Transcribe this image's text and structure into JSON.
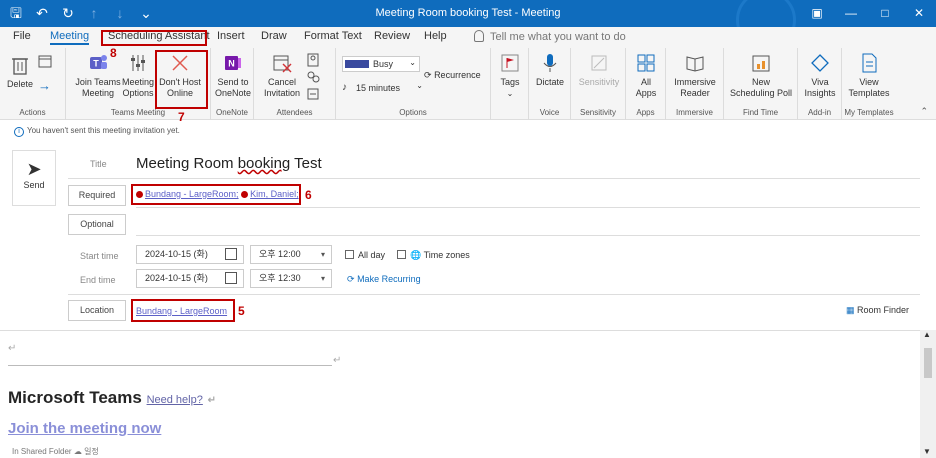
{
  "window": {
    "title": "Meeting Room booking Test  -  Meeting",
    "qat_icons": [
      "save-icon",
      "undo-icon",
      "redo-icon",
      "up-icon",
      "down-icon",
      "more-icon"
    ],
    "controls": [
      "ribbon-display-icon",
      "minimize-icon",
      "maximize-icon",
      "close-icon"
    ]
  },
  "tabs": [
    "File",
    "Meeting",
    "Scheduling Assistant",
    "Insert",
    "Draw",
    "Format Text",
    "Review",
    "Help"
  ],
  "active_tab": "Meeting",
  "tell_me": "Tell me what you want to do",
  "ribbon": {
    "actions": {
      "delete": "Delete",
      "group": "Actions"
    },
    "teams": {
      "join1": "Join Teams",
      "join2": "Meeting",
      "opt1": "Meeting",
      "opt2": "Options",
      "dont1": "Don't Host",
      "dont2": "Online",
      "group": "Teams Meeting"
    },
    "onenote": {
      "label1": "Send to",
      "label2": "OneNote",
      "group": "OneNote"
    },
    "attendees": {
      "cancel1": "Cancel",
      "cancel2": "Invitation",
      "group": "Attendees"
    },
    "options": {
      "busy": "Busy",
      "reminder": "15 minutes",
      "recurrence": "Recurrence",
      "group": "Options"
    },
    "tags": {
      "label": "Tags"
    },
    "voice": {
      "label": "Dictate",
      "group": "Voice"
    },
    "sensitivity": {
      "label": "Sensitivity",
      "group": "Sensitivity"
    },
    "apps": {
      "label1": "All",
      "label2": "Apps",
      "group": "Apps"
    },
    "immersive": {
      "label1": "Immersive",
      "label2": "Reader",
      "group": "Immersive"
    },
    "findtime": {
      "label1": "New",
      "label2": "Scheduling Poll",
      "group": "Find Time"
    },
    "addin": {
      "label1": "Viva",
      "label2": "Insights",
      "group": "Add-in"
    },
    "templates": {
      "label1": "View",
      "label2": "Templates",
      "group": "My Templates"
    }
  },
  "annotations": {
    "n8": "8",
    "n7": "7",
    "n6": "6",
    "n5": "5"
  },
  "info_bar": "You haven't sent this meeting invitation yet.",
  "form": {
    "send": "Send",
    "title_label": "Title",
    "title_value_a": "Meeting Room ",
    "title_value_b": "booking",
    "title_value_c": " Test",
    "required": "Required",
    "optional": "Optional",
    "attendee1": "Bundang - LargeRoom;",
    "attendee2": "Kim, Daniel;",
    "start_label": "Start time",
    "end_label": "End time",
    "start_date": "2024-10-15 (화)",
    "end_date": "2024-10-15 (화)",
    "start_time": "오후 12:00",
    "end_time": "오후 12:30",
    "all_day": "All day",
    "time_zones": "Time zones",
    "make_recurring": "Make Recurring",
    "location": "Location",
    "location_value": "Bundang - LargeRoom",
    "room_finder": "Room Finder"
  },
  "body": {
    "teams_title": "Microsoft Teams",
    "need_help": "Need help?",
    "join": "Join the meeting now",
    "status_folder": "In Shared Folder",
    "status_word": "일정"
  }
}
